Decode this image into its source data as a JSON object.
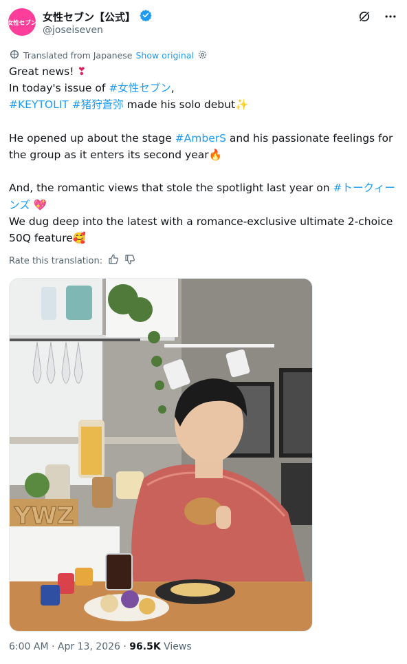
{
  "account": {
    "display_name": "女性セブン【公式】",
    "handle": "@joseiseven",
    "avatar_text": "女性セブン",
    "verified_icon": "verified-badge-icon"
  },
  "header_icons": [
    "grok-icon",
    "more-icon"
  ],
  "translation": {
    "label": "Translated from Japanese",
    "link": "Show original"
  },
  "tweet": {
    "line1": "Great news! ",
    "emoji1": "❣",
    "line2_prefix": "In today's issue of ",
    "line2_tag": "#女性セブン",
    "line2_suffix": ",",
    "line3_tag1": "#KEYTOLIT",
    "line3_tag2": "#猪狩蒼弥",
    "line3_suffix": " made his solo debut",
    "emoji2": "✨",
    "line4_prefix": "He opened up about the stage ",
    "line4_tag": "#AmberS",
    "line4_suffix": " and his passionate feelings for",
    "line5": "the group as it enters its second year",
    "emoji3": "🔥",
    "line6_prefix": "And, the romantic views that stole the spotlight last year on ",
    "line6_tag_a": "#トークィー",
    "line7_tag_b": "ンズ",
    "emoji4": "💖",
    "line8": "We dug deep into the latest with a romance-exclusive ultimate 2-choice",
    "line9": "50Q feature",
    "emoji5": "🥰"
  },
  "rate": {
    "label": "Rate this translation:"
  },
  "photo": {
    "sign_text": "YWZ"
  },
  "meta": {
    "time": "6:00 AM",
    "date": "Apr 13, 2026",
    "views_count": "96.5K",
    "views_label": "Views"
  },
  "colors": {
    "link": "#1d9bf0",
    "secondary": "#536471",
    "avatar": "#ff3d9a"
  }
}
